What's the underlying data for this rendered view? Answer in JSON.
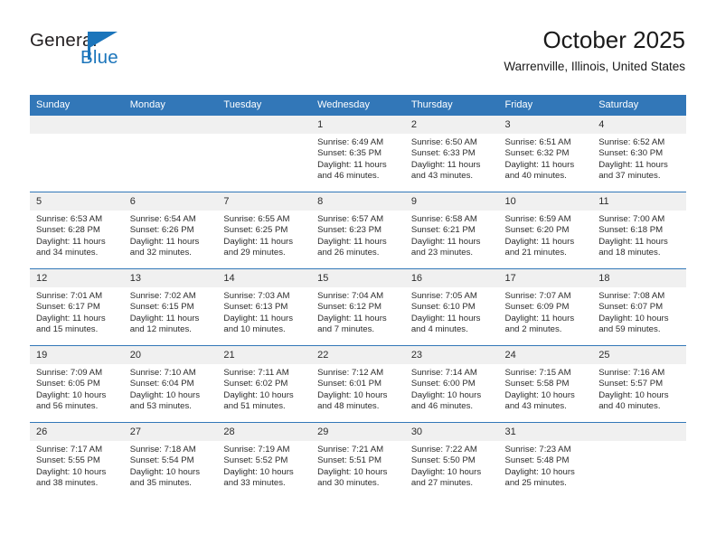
{
  "brand": {
    "name_top": "General",
    "name_bottom": "Blue",
    "accent_color": "#1b75bb"
  },
  "header": {
    "title": "October 2025",
    "location": "Warrenville, Illinois, United States"
  },
  "theme": {
    "header_row_bg": "#3277b8",
    "daynum_bg": "#f0f0f0",
    "rule_color": "#3277b8",
    "text_color": "#2c2c2c"
  },
  "calendar": {
    "weekday_headers": [
      "Sunday",
      "Monday",
      "Tuesday",
      "Wednesday",
      "Thursday",
      "Friday",
      "Saturday"
    ],
    "weeks": [
      [
        {
          "day": "",
          "sunrise": "",
          "sunset": "",
          "daylight_line1": "",
          "daylight_line2": "",
          "blank": true
        },
        {
          "day": "",
          "sunrise": "",
          "sunset": "",
          "daylight_line1": "",
          "daylight_line2": "",
          "blank": true
        },
        {
          "day": "",
          "sunrise": "",
          "sunset": "",
          "daylight_line1": "",
          "daylight_line2": "",
          "blank": true
        },
        {
          "day": "1",
          "sunrise": "Sunrise: 6:49 AM",
          "sunset": "Sunset: 6:35 PM",
          "daylight_line1": "Daylight: 11 hours",
          "daylight_line2": "and 46 minutes."
        },
        {
          "day": "2",
          "sunrise": "Sunrise: 6:50 AM",
          "sunset": "Sunset: 6:33 PM",
          "daylight_line1": "Daylight: 11 hours",
          "daylight_line2": "and 43 minutes."
        },
        {
          "day": "3",
          "sunrise": "Sunrise: 6:51 AM",
          "sunset": "Sunset: 6:32 PM",
          "daylight_line1": "Daylight: 11 hours",
          "daylight_line2": "and 40 minutes."
        },
        {
          "day": "4",
          "sunrise": "Sunrise: 6:52 AM",
          "sunset": "Sunset: 6:30 PM",
          "daylight_line1": "Daylight: 11 hours",
          "daylight_line2": "and 37 minutes."
        }
      ],
      [
        {
          "day": "5",
          "sunrise": "Sunrise: 6:53 AM",
          "sunset": "Sunset: 6:28 PM",
          "daylight_line1": "Daylight: 11 hours",
          "daylight_line2": "and 34 minutes."
        },
        {
          "day": "6",
          "sunrise": "Sunrise: 6:54 AM",
          "sunset": "Sunset: 6:26 PM",
          "daylight_line1": "Daylight: 11 hours",
          "daylight_line2": "and 32 minutes."
        },
        {
          "day": "7",
          "sunrise": "Sunrise: 6:55 AM",
          "sunset": "Sunset: 6:25 PM",
          "daylight_line1": "Daylight: 11 hours",
          "daylight_line2": "and 29 minutes."
        },
        {
          "day": "8",
          "sunrise": "Sunrise: 6:57 AM",
          "sunset": "Sunset: 6:23 PM",
          "daylight_line1": "Daylight: 11 hours",
          "daylight_line2": "and 26 minutes."
        },
        {
          "day": "9",
          "sunrise": "Sunrise: 6:58 AM",
          "sunset": "Sunset: 6:21 PM",
          "daylight_line1": "Daylight: 11 hours",
          "daylight_line2": "and 23 minutes."
        },
        {
          "day": "10",
          "sunrise": "Sunrise: 6:59 AM",
          "sunset": "Sunset: 6:20 PM",
          "daylight_line1": "Daylight: 11 hours",
          "daylight_line2": "and 21 minutes."
        },
        {
          "day": "11",
          "sunrise": "Sunrise: 7:00 AM",
          "sunset": "Sunset: 6:18 PM",
          "daylight_line1": "Daylight: 11 hours",
          "daylight_line2": "and 18 minutes."
        }
      ],
      [
        {
          "day": "12",
          "sunrise": "Sunrise: 7:01 AM",
          "sunset": "Sunset: 6:17 PM",
          "daylight_line1": "Daylight: 11 hours",
          "daylight_line2": "and 15 minutes."
        },
        {
          "day": "13",
          "sunrise": "Sunrise: 7:02 AM",
          "sunset": "Sunset: 6:15 PM",
          "daylight_line1": "Daylight: 11 hours",
          "daylight_line2": "and 12 minutes."
        },
        {
          "day": "14",
          "sunrise": "Sunrise: 7:03 AM",
          "sunset": "Sunset: 6:13 PM",
          "daylight_line1": "Daylight: 11 hours",
          "daylight_line2": "and 10 minutes."
        },
        {
          "day": "15",
          "sunrise": "Sunrise: 7:04 AM",
          "sunset": "Sunset: 6:12 PM",
          "daylight_line1": "Daylight: 11 hours",
          "daylight_line2": "and 7 minutes."
        },
        {
          "day": "16",
          "sunrise": "Sunrise: 7:05 AM",
          "sunset": "Sunset: 6:10 PM",
          "daylight_line1": "Daylight: 11 hours",
          "daylight_line2": "and 4 minutes."
        },
        {
          "day": "17",
          "sunrise": "Sunrise: 7:07 AM",
          "sunset": "Sunset: 6:09 PM",
          "daylight_line1": "Daylight: 11 hours",
          "daylight_line2": "and 2 minutes."
        },
        {
          "day": "18",
          "sunrise": "Sunrise: 7:08 AM",
          "sunset": "Sunset: 6:07 PM",
          "daylight_line1": "Daylight: 10 hours",
          "daylight_line2": "and 59 minutes."
        }
      ],
      [
        {
          "day": "19",
          "sunrise": "Sunrise: 7:09 AM",
          "sunset": "Sunset: 6:05 PM",
          "daylight_line1": "Daylight: 10 hours",
          "daylight_line2": "and 56 minutes."
        },
        {
          "day": "20",
          "sunrise": "Sunrise: 7:10 AM",
          "sunset": "Sunset: 6:04 PM",
          "daylight_line1": "Daylight: 10 hours",
          "daylight_line2": "and 53 minutes."
        },
        {
          "day": "21",
          "sunrise": "Sunrise: 7:11 AM",
          "sunset": "Sunset: 6:02 PM",
          "daylight_line1": "Daylight: 10 hours",
          "daylight_line2": "and 51 minutes."
        },
        {
          "day": "22",
          "sunrise": "Sunrise: 7:12 AM",
          "sunset": "Sunset: 6:01 PM",
          "daylight_line1": "Daylight: 10 hours",
          "daylight_line2": "and 48 minutes."
        },
        {
          "day": "23",
          "sunrise": "Sunrise: 7:14 AM",
          "sunset": "Sunset: 6:00 PM",
          "daylight_line1": "Daylight: 10 hours",
          "daylight_line2": "and 46 minutes."
        },
        {
          "day": "24",
          "sunrise": "Sunrise: 7:15 AM",
          "sunset": "Sunset: 5:58 PM",
          "daylight_line1": "Daylight: 10 hours",
          "daylight_line2": "and 43 minutes."
        },
        {
          "day": "25",
          "sunrise": "Sunrise: 7:16 AM",
          "sunset": "Sunset: 5:57 PM",
          "daylight_line1": "Daylight: 10 hours",
          "daylight_line2": "and 40 minutes."
        }
      ],
      [
        {
          "day": "26",
          "sunrise": "Sunrise: 7:17 AM",
          "sunset": "Sunset: 5:55 PM",
          "daylight_line1": "Daylight: 10 hours",
          "daylight_line2": "and 38 minutes."
        },
        {
          "day": "27",
          "sunrise": "Sunrise: 7:18 AM",
          "sunset": "Sunset: 5:54 PM",
          "daylight_line1": "Daylight: 10 hours",
          "daylight_line2": "and 35 minutes."
        },
        {
          "day": "28",
          "sunrise": "Sunrise: 7:19 AM",
          "sunset": "Sunset: 5:52 PM",
          "daylight_line1": "Daylight: 10 hours",
          "daylight_line2": "and 33 minutes."
        },
        {
          "day": "29",
          "sunrise": "Sunrise: 7:21 AM",
          "sunset": "Sunset: 5:51 PM",
          "daylight_line1": "Daylight: 10 hours",
          "daylight_line2": "and 30 minutes."
        },
        {
          "day": "30",
          "sunrise": "Sunrise: 7:22 AM",
          "sunset": "Sunset: 5:50 PM",
          "daylight_line1": "Daylight: 10 hours",
          "daylight_line2": "and 27 minutes."
        },
        {
          "day": "31",
          "sunrise": "Sunrise: 7:23 AM",
          "sunset": "Sunset: 5:48 PM",
          "daylight_line1": "Daylight: 10 hours",
          "daylight_line2": "and 25 minutes."
        },
        {
          "day": "",
          "sunrise": "",
          "sunset": "",
          "daylight_line1": "",
          "daylight_line2": "",
          "blank": true
        }
      ]
    ]
  }
}
